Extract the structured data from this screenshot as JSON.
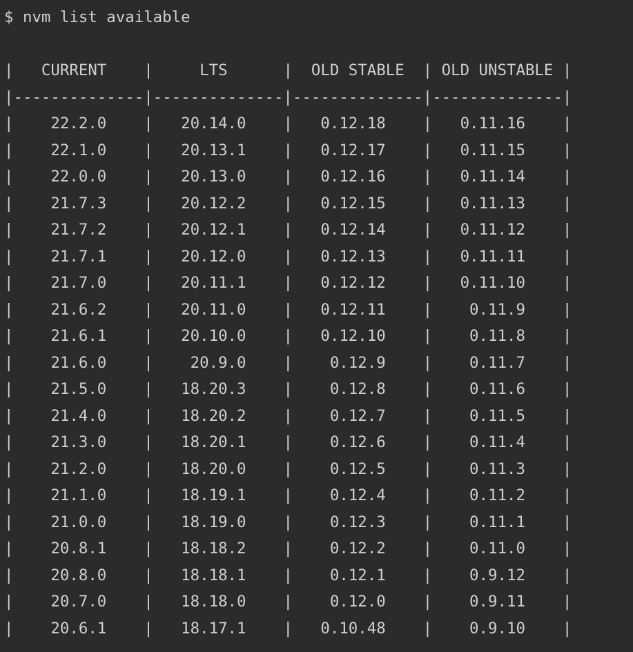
{
  "command": "$ nvm list available",
  "table": {
    "headers": [
      "CURRENT",
      "LTS",
      "OLD STABLE",
      "OLD UNSTABLE"
    ],
    "separator": "|--------------|--------------|--------------|--------------|",
    "rows": [
      [
        "22.2.0",
        "20.14.0",
        "0.12.18",
        "0.11.16"
      ],
      [
        "22.1.0",
        "20.13.1",
        "0.12.17",
        "0.11.15"
      ],
      [
        "22.0.0",
        "20.13.0",
        "0.12.16",
        "0.11.14"
      ],
      [
        "21.7.3",
        "20.12.2",
        "0.12.15",
        "0.11.13"
      ],
      [
        "21.7.2",
        "20.12.1",
        "0.12.14",
        "0.11.12"
      ],
      [
        "21.7.1",
        "20.12.0",
        "0.12.13",
        "0.11.11"
      ],
      [
        "21.7.0",
        "20.11.1",
        "0.12.12",
        "0.11.10"
      ],
      [
        "21.6.2",
        "20.11.0",
        "0.12.11",
        "0.11.9"
      ],
      [
        "21.6.1",
        "20.10.0",
        "0.12.10",
        "0.11.8"
      ],
      [
        "21.6.0",
        "20.9.0",
        "0.12.9",
        "0.11.7"
      ],
      [
        "21.5.0",
        "18.20.3",
        "0.12.8",
        "0.11.6"
      ],
      [
        "21.4.0",
        "18.20.2",
        "0.12.7",
        "0.11.5"
      ],
      [
        "21.3.0",
        "18.20.1",
        "0.12.6",
        "0.11.4"
      ],
      [
        "21.2.0",
        "18.20.0",
        "0.12.5",
        "0.11.3"
      ],
      [
        "21.1.0",
        "18.19.1",
        "0.12.4",
        "0.11.2"
      ],
      [
        "21.0.0",
        "18.19.0",
        "0.12.3",
        "0.11.1"
      ],
      [
        "20.8.1",
        "18.18.2",
        "0.12.2",
        "0.11.0"
      ],
      [
        "20.8.0",
        "18.18.1",
        "0.12.1",
        "0.9.12"
      ],
      [
        "20.7.0",
        "18.18.0",
        "0.12.0",
        "0.9.11"
      ],
      [
        "20.6.1",
        "18.17.1",
        "0.10.48",
        "0.9.10"
      ]
    ]
  }
}
